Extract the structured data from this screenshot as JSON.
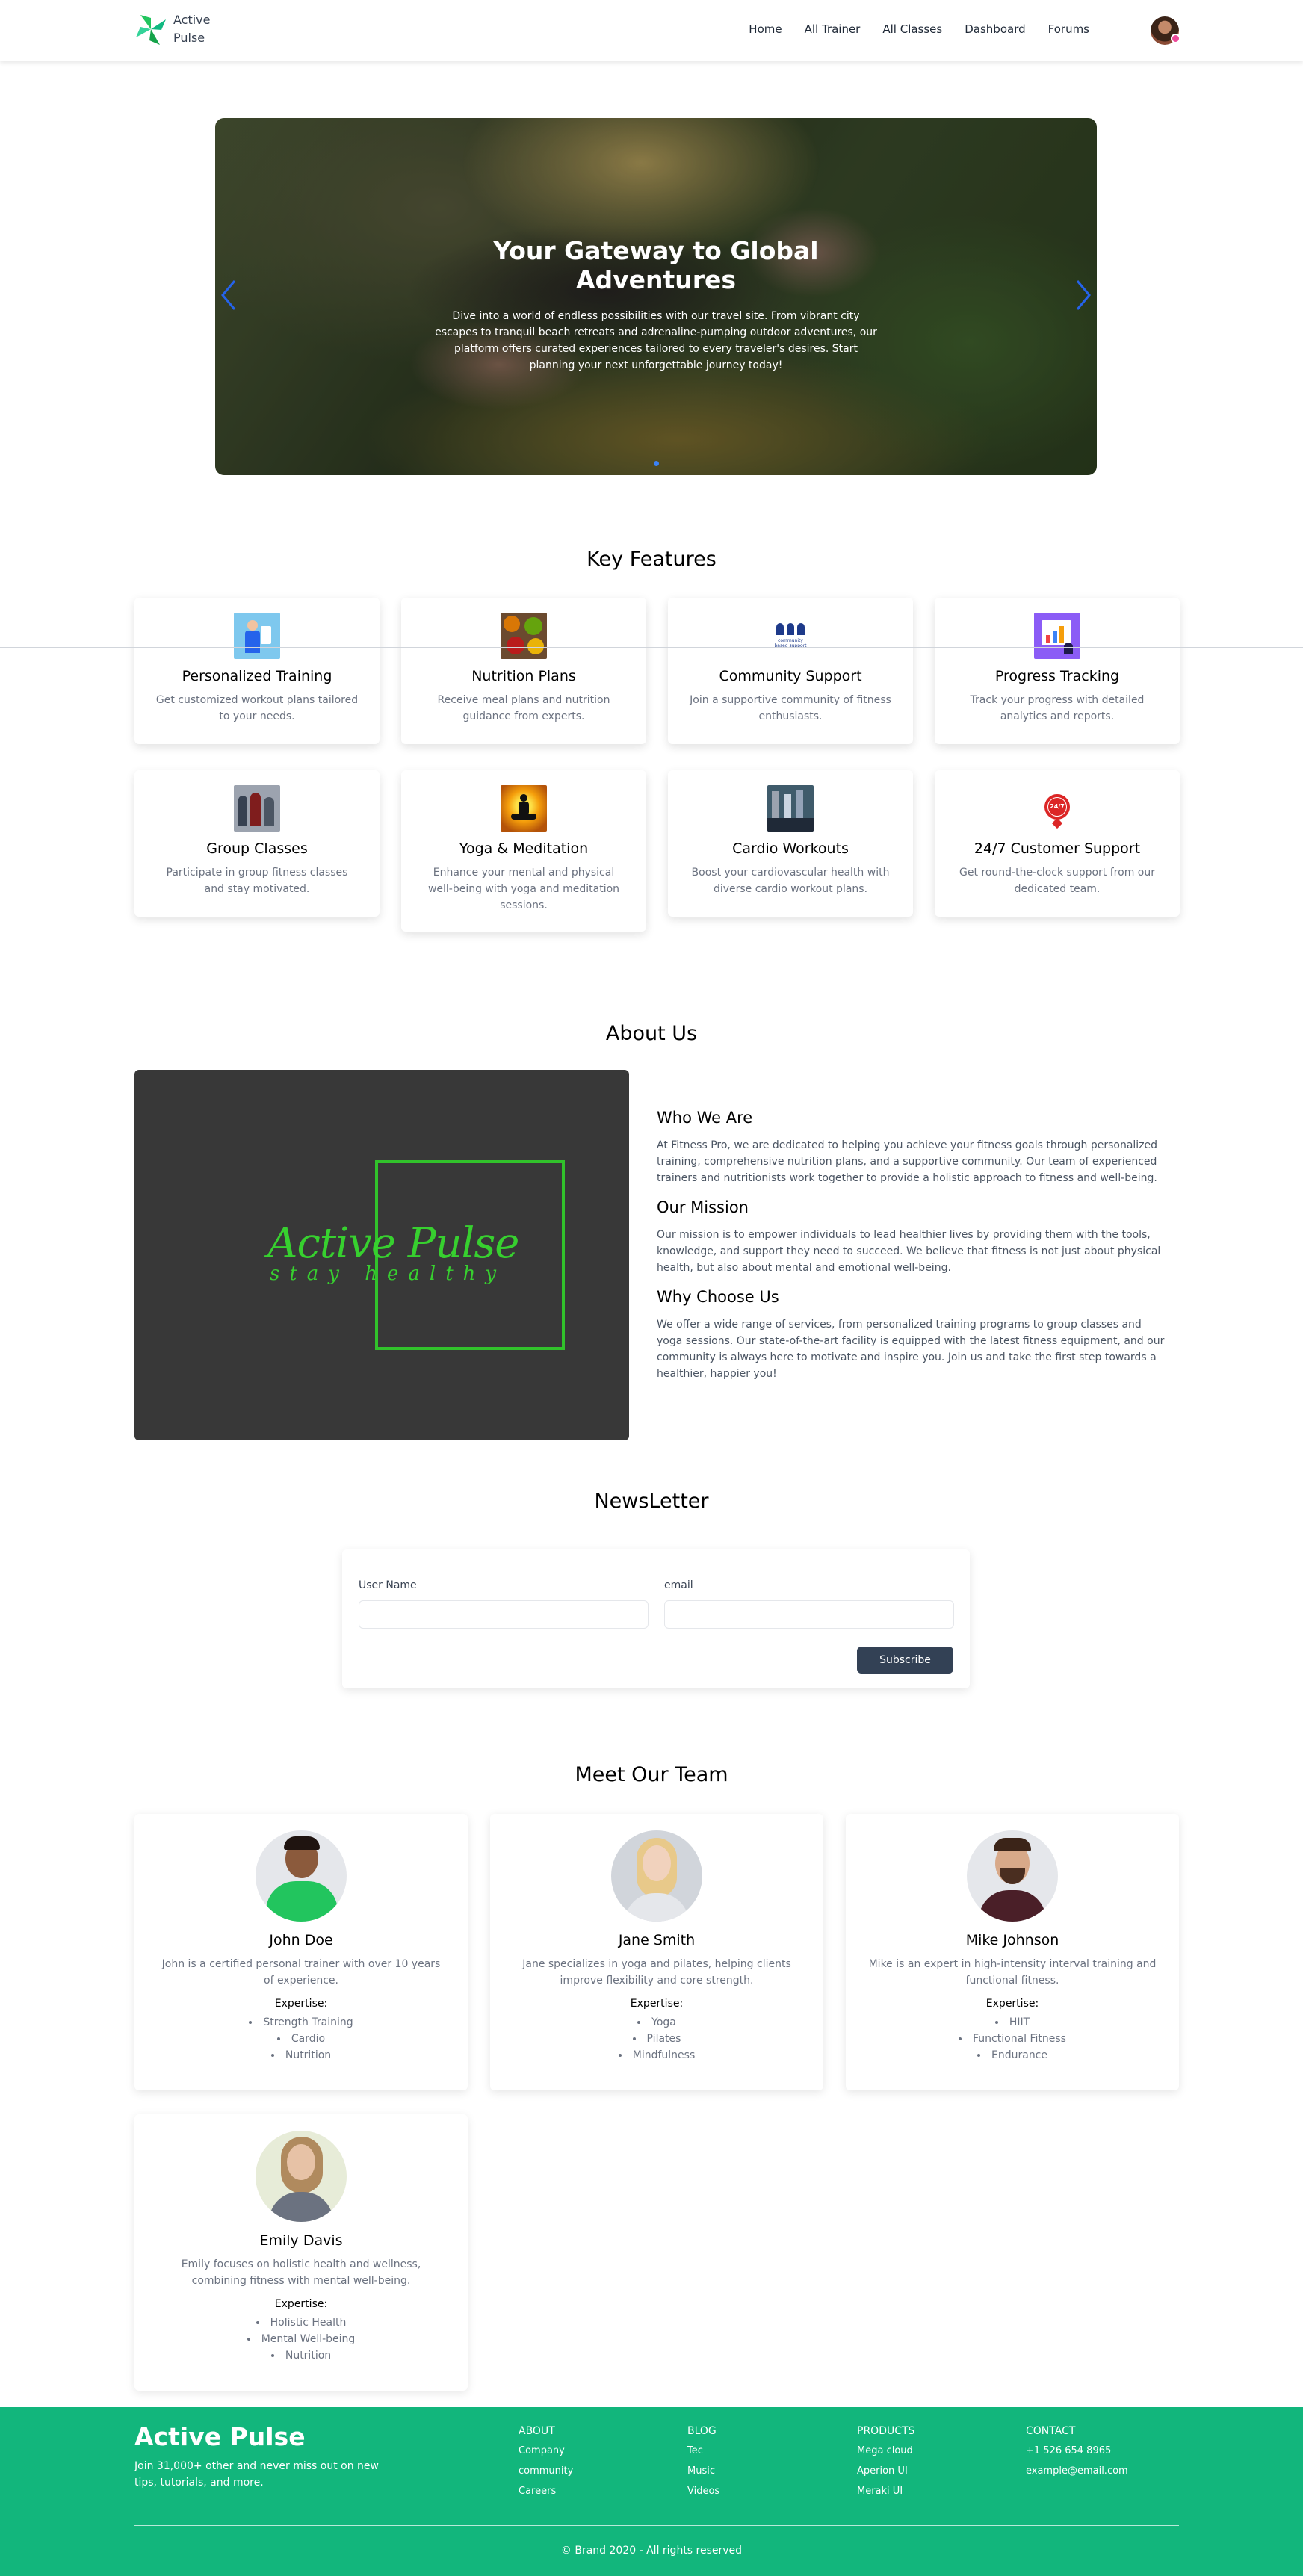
{
  "nav": {
    "logo_line1": "Active",
    "logo_line2": "Pulse",
    "links": [
      "Home",
      "All Trainer",
      "All Classes",
      "Dashboard",
      "Forums"
    ]
  },
  "hero": {
    "title": "Your Gateway to Global Adventures",
    "description": "Dive into a world of endless possibilities with our travel site. From vibrant city escapes to tranquil beach retreats and adrenaline-pumping outdoor adventures, our platform offers curated experiences tailored to every traveler's desires. Start planning your next unforgettable journey today!"
  },
  "features": {
    "title": "Key Features",
    "items": [
      {
        "title": "Personalized Training",
        "desc": "Get customized workout plans tailored to your needs.",
        "icon": "trainer-image"
      },
      {
        "title": "Nutrition Plans",
        "desc": "Receive meal plans and nutrition guidance from experts.",
        "icon": "food-image"
      },
      {
        "title": "Community Support",
        "desc": "Join a supportive community of fitness enthusiasts.",
        "icon": "community-image",
        "icon_text": "community\nbased support"
      },
      {
        "title": "Progress Tracking",
        "desc": "Track your progress with detailed analytics and reports.",
        "icon": "analytics-image"
      },
      {
        "title": "Group Classes",
        "desc": "Participate in group fitness classes and stay motivated.",
        "icon": "group-class-image"
      },
      {
        "title": "Yoga & Meditation",
        "desc": "Enhance your mental and physical well-being with yoga and meditation sessions.",
        "icon": "meditation-image"
      },
      {
        "title": "Cardio Workouts",
        "desc": "Boost your cardiovascular health with diverse cardio workout plans.",
        "icon": "gym-image"
      },
      {
        "title": "24/7 Customer Support",
        "desc": "Get round-the-clock support from our dedicated team.",
        "icon": "support-24-7-image",
        "icon_text": "24/7"
      }
    ]
  },
  "about": {
    "title": "About Us",
    "brand": "Active Pulse",
    "tagline": "stay healthy",
    "sections": [
      {
        "heading": "Who We Are",
        "text": "At Fitness Pro, we are dedicated to helping you achieve your fitness goals through personalized training, comprehensive nutrition plans, and a supportive community. Our team of experienced trainers and nutritionists work together to provide a holistic approach to fitness and well-being."
      },
      {
        "heading": "Our Mission",
        "text": "Our mission is to empower individuals to lead healthier lives by providing them with the tools, knowledge, and support they need to succeed. We believe that fitness is not just about physical health, but also about mental and emotional well-being."
      },
      {
        "heading": "Why Choose Us",
        "text": "We offer a wide range of services, from personalized training programs to group classes and yoga sessions. Our state-of-the-art facility is equipped with the latest fitness equipment, and our community is always here to motivate and inspire you. Join us and take the first step towards a healthier, happier you!"
      }
    ]
  },
  "newsletter": {
    "title": "NewsLetter",
    "name_label": "User Name",
    "email_label": "email",
    "name_value": "",
    "email_value": "",
    "button": "Subscribe"
  },
  "team": {
    "title": "Meet Our Team",
    "expertise_label": "Expertise:",
    "members": [
      {
        "name": "John Doe",
        "bio": "John is a certified personal trainer with over 10 years of experience.",
        "skills": [
          "Strength Training",
          "Cardio",
          "Nutrition"
        ]
      },
      {
        "name": "Jane Smith",
        "bio": "Jane specializes in yoga and pilates, helping clients improve flexibility and core strength.",
        "skills": [
          "Yoga",
          "Pilates",
          "Mindfulness"
        ]
      },
      {
        "name": "Mike Johnson",
        "bio": "Mike is an expert in high-intensity interval training and functional fitness.",
        "skills": [
          "HIIT",
          "Functional Fitness",
          "Endurance"
        ]
      },
      {
        "name": "Emily Davis",
        "bio": "Emily focuses on holistic health and wellness, combining fitness with mental well-being.",
        "skills": [
          "Holistic Health",
          "Mental Well-being",
          "Nutrition"
        ]
      }
    ]
  },
  "footer": {
    "brand": "Active Pulse",
    "tagline": "Join 31,000+ other and never miss out on new tips, tutorials, and more.",
    "columns": [
      {
        "title": "ABOUT",
        "links": [
          "Company",
          "community",
          "Careers"
        ]
      },
      {
        "title": "BLOG",
        "links": [
          "Tec",
          "Music",
          "Videos"
        ]
      },
      {
        "title": "PRODUCTS",
        "links": [
          "Mega cloud",
          "Aperion UI",
          "Meraki UI"
        ]
      },
      {
        "title": "CONTACT",
        "links": [
          "+1 526 654 8965",
          "example@email.com"
        ]
      }
    ],
    "copyright": "© Brand 2020 - All rights reserved"
  },
  "colors": {
    "footer_bg": "#12b67c",
    "brand_green": "#37d02f",
    "button_dark": "#334155",
    "carousel_accent": "#3b82f6"
  }
}
